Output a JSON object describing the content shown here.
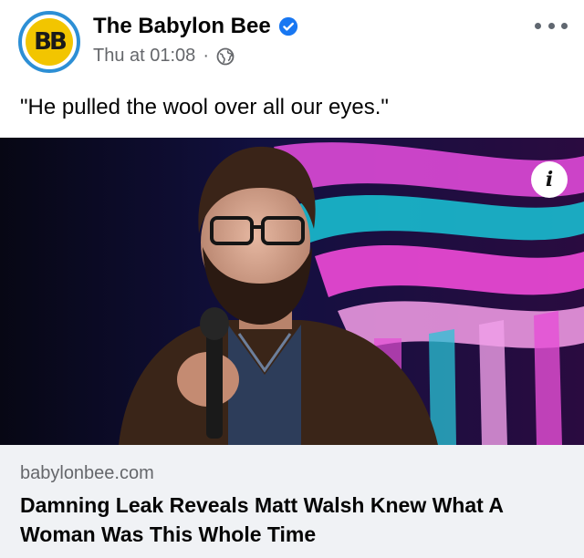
{
  "post": {
    "page_name": "The Babylon Bee",
    "timestamp": "Thu at 01:08",
    "separator": "·",
    "audience_icon": "globe-icon",
    "verified_icon": "verified-badge-icon",
    "caption": "\"He pulled the wool over all our eyes.\""
  },
  "avatar": {
    "logo_text": "BB"
  },
  "media": {
    "info_label": "i"
  },
  "link_preview": {
    "domain": "babylonbee.com",
    "title": "Damning Leak Reveals Matt Walsh Knew What A Woman Was This Whole Time"
  },
  "colors": {
    "verified_blue": "#1877f2",
    "avatar_ring": "#2d8fd5",
    "avatar_fill": "#f2c500",
    "preview_bg": "#f0f2f5",
    "meta_gray": "#65676b"
  }
}
